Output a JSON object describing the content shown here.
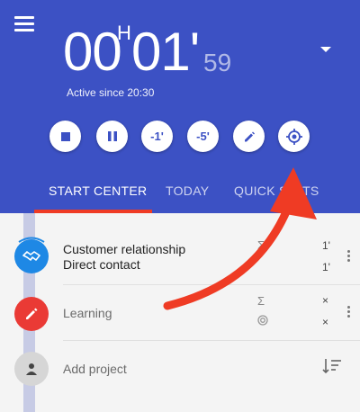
{
  "header": {
    "timer": {
      "hours": "00",
      "hour_unit": "H",
      "minutes": "01'",
      "seconds": "59"
    },
    "active_since": "Active since 20:30",
    "buttons": [
      {
        "name": "stop-button",
        "label": "■",
        "icon": "stop-icon"
      },
      {
        "name": "pause-button",
        "label": "❚❚",
        "icon": "pause-icon"
      },
      {
        "name": "minus-1-button",
        "label": "-1'"
      },
      {
        "name": "minus-5-button",
        "label": "-5'"
      },
      {
        "name": "edit-button",
        "label": "",
        "icon": "pencil-icon"
      },
      {
        "name": "locate-button",
        "label": "",
        "icon": "crosshair-icon"
      }
    ]
  },
  "tabs": [
    {
      "label": "START CENTER",
      "active": true
    },
    {
      "label": "TODAY",
      "active": false
    },
    {
      "label": "QUICK STATS",
      "active": false
    }
  ],
  "projects": [
    {
      "title_line1": "Customer relationship",
      "title_line2": "Direct contact",
      "icon": "handshake-icon",
      "color": "#1e88e5",
      "value1": "1'",
      "value2": "1'"
    },
    {
      "title": "Learning",
      "icon": "pencil-icon",
      "color": "#ea3a35",
      "value1": "×",
      "value2": "×"
    }
  ],
  "add_project": {
    "label": "Add project",
    "icon": "person-icon",
    "sort_icon": "sort-icon"
  },
  "colors": {
    "header": "#3c51c4",
    "tab_indicator": "#ef3b24",
    "annotation_arrow": "#ef3b24"
  }
}
